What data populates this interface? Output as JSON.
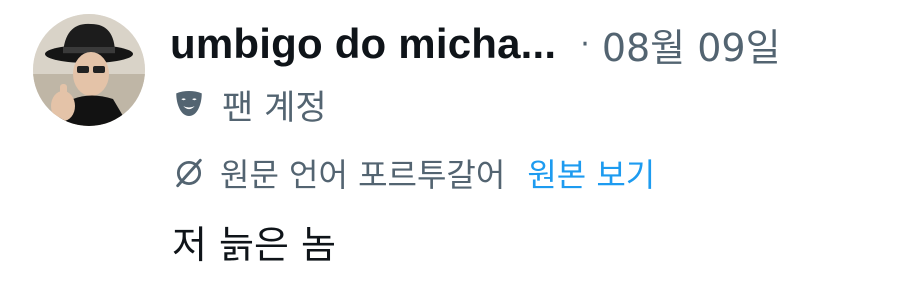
{
  "header": {
    "display_name": "umbigo do micha...",
    "separator": "·",
    "date": "08월 09일"
  },
  "badge": {
    "icon": "theater-mask-icon",
    "label": "팬 계정"
  },
  "translation": {
    "icon": "translate-off-icon",
    "label": "원문 언어 포르투갈어",
    "show_original_link": "원본 보기"
  },
  "tweet": {
    "text": "저 늙은 놈"
  },
  "colors": {
    "primary_text": "#0f1419",
    "secondary_text": "#536471",
    "link": "#1d9bf0"
  }
}
